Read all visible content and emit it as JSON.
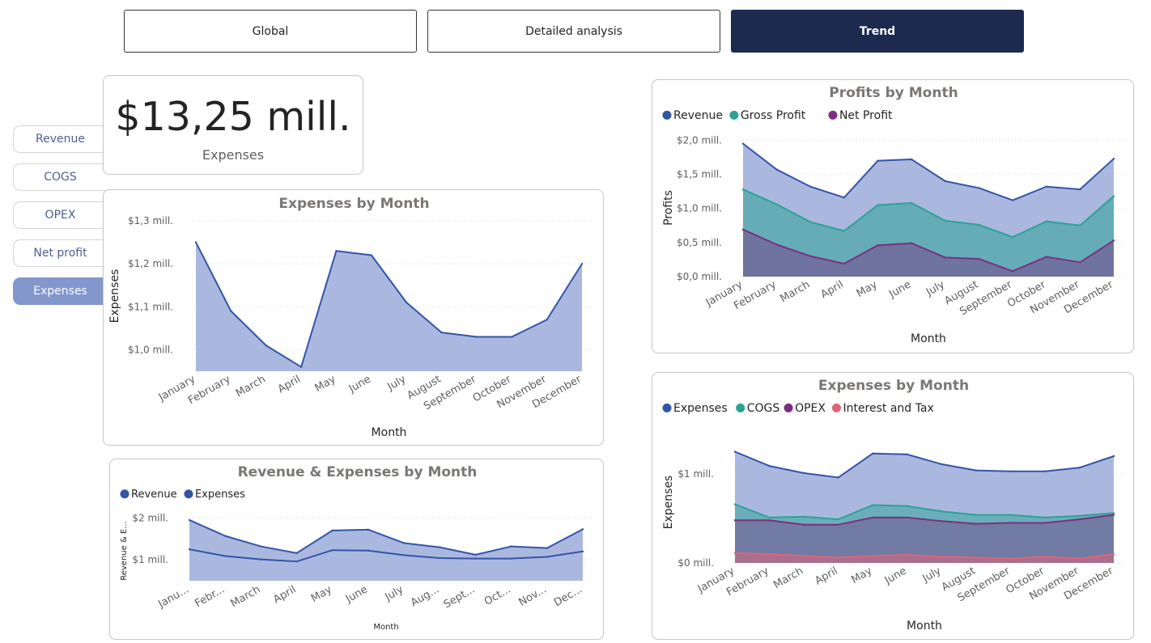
{
  "tabs": [
    {
      "label": "Global",
      "active": false
    },
    {
      "label": "Detailed analysis",
      "active": false
    },
    {
      "label": "Trend",
      "active": true
    }
  ],
  "sidebar": [
    {
      "label": "Revenue",
      "active": false
    },
    {
      "label": "COGS",
      "active": false
    },
    {
      "label": "OPEX",
      "active": false
    },
    {
      "label": "Net profit",
      "active": false
    },
    {
      "label": "Expenses",
      "active": true
    }
  ],
  "kpi": {
    "value": "$13,25 mill.",
    "label": "Expenses"
  },
  "colors": {
    "revenue": "#3355a6",
    "teal": "#2ba393",
    "purple": "#7b2f82",
    "pink": "#e0637a",
    "active_tab": "#1b2a4e",
    "active_side": "#8397cc"
  },
  "chart_data": [
    {
      "id": "expenses_by_month",
      "type": "area",
      "title": "Expenses by Month",
      "xlabel": "Month",
      "ylabel": "Expenses",
      "categories": [
        "January",
        "February",
        "March",
        "April",
        "May",
        "June",
        "July",
        "August",
        "September",
        "October",
        "November",
        "December"
      ],
      "series": [
        {
          "values": [
            1.25,
            1.09,
            1.01,
            0.96,
            1.23,
            1.22,
            1.11,
            1.04,
            1.03,
            1.03,
            1.07,
            1.2
          ]
        }
      ],
      "ylim": [
        0.95,
        1.3
      ],
      "yticks": [
        {
          "v": 1.0,
          "label": "$1,0 mill."
        },
        {
          "v": 1.1,
          "label": "$1,1 mill."
        },
        {
          "v": 1.2,
          "label": "$1,2 mill."
        },
        {
          "v": 1.3,
          "label": "$1,3 mill."
        }
      ],
      "grid": true
    },
    {
      "id": "revenue_expenses_by_month",
      "type": "area",
      "title": "Revenue & Expenses by Month",
      "xlabel": "Month",
      "ylabel": "Revenue & E...",
      "categories": [
        "Janu...",
        "Febr...",
        "March",
        "April",
        "May",
        "June",
        "July",
        "Aug...",
        "Sept...",
        "Oct...",
        "Nov...",
        "Dec..."
      ],
      "series": [
        {
          "name": "Revenue",
          "values": [
            1.95,
            1.57,
            1.32,
            1.16,
            1.7,
            1.72,
            1.4,
            1.3,
            1.12,
            1.32,
            1.28,
            1.73
          ]
        },
        {
          "name": "Expenses",
          "values": [
            1.25,
            1.09,
            1.01,
            0.96,
            1.23,
            1.22,
            1.11,
            1.04,
            1.03,
            1.03,
            1.07,
            1.2
          ]
        }
      ],
      "ylim": [
        0.5,
        2.2
      ],
      "yticks": [
        {
          "v": 1,
          "label": "$1 mill."
        },
        {
          "v": 2,
          "label": "$2 mill."
        }
      ],
      "legend": "top-left",
      "grid": true
    },
    {
      "id": "profits_by_month",
      "type": "area",
      "title": "Profits by Month",
      "xlabel": "Month",
      "ylabel": "Profits",
      "categories": [
        "January",
        "February",
        "March",
        "April",
        "May",
        "June",
        "July",
        "August",
        "September",
        "October",
        "November",
        "December"
      ],
      "series": [
        {
          "name": "Revenue",
          "values": [
            1.95,
            1.57,
            1.32,
            1.16,
            1.7,
            1.72,
            1.4,
            1.3,
            1.12,
            1.32,
            1.28,
            1.73
          ]
        },
        {
          "name": "Gross Profit",
          "values": [
            1.28,
            1.06,
            0.8,
            0.67,
            1.05,
            1.08,
            0.82,
            0.76,
            0.58,
            0.81,
            0.75,
            1.18
          ]
        },
        {
          "name": "Net Profit",
          "values": [
            0.69,
            0.47,
            0.3,
            0.19,
            0.46,
            0.49,
            0.28,
            0.26,
            0.08,
            0.29,
            0.21,
            0.53
          ]
        }
      ],
      "ylim": [
        0,
        2.1
      ],
      "yticks": [
        {
          "v": 0,
          "label": "$0,0 mill."
        },
        {
          "v": 0.5,
          "label": "$0,5 mill."
        },
        {
          "v": 1.0,
          "label": "$1,0 mill."
        },
        {
          "v": 1.5,
          "label": "$1,5 mill."
        },
        {
          "v": 2.0,
          "label": "$2,0 mill."
        }
      ],
      "legend": "top-left",
      "grid": true
    },
    {
      "id": "expenses_breakdown_by_month",
      "type": "area",
      "title": "Expenses by Month",
      "xlabel": "Month",
      "ylabel": "Expenses",
      "categories": [
        "January",
        "February",
        "March",
        "April",
        "May",
        "June",
        "July",
        "August",
        "September",
        "October",
        "November",
        "December"
      ],
      "series": [
        {
          "name": "Expenses",
          "values": [
            1.25,
            1.09,
            1.01,
            0.96,
            1.23,
            1.22,
            1.11,
            1.04,
            1.03,
            1.03,
            1.07,
            1.2
          ]
        },
        {
          "name": "COGS",
          "values": [
            0.66,
            0.51,
            0.52,
            0.49,
            0.65,
            0.64,
            0.58,
            0.54,
            0.54,
            0.51,
            0.53,
            0.56
          ]
        },
        {
          "name": "OPEX",
          "values": [
            0.48,
            0.48,
            0.43,
            0.43,
            0.51,
            0.51,
            0.47,
            0.44,
            0.45,
            0.45,
            0.49,
            0.54
          ]
        },
        {
          "name": "Interest and Tax",
          "values": [
            0.11,
            0.1,
            0.08,
            0.06,
            0.08,
            0.09,
            0.07,
            0.06,
            0.05,
            0.07,
            0.05,
            0.1
          ]
        }
      ],
      "ylim": [
        0,
        1.4
      ],
      "yticks": [
        {
          "v": 0,
          "label": "$0 mill."
        },
        {
          "v": 1,
          "label": "$1 mill."
        }
      ],
      "legend": "top-left",
      "grid": true
    }
  ]
}
